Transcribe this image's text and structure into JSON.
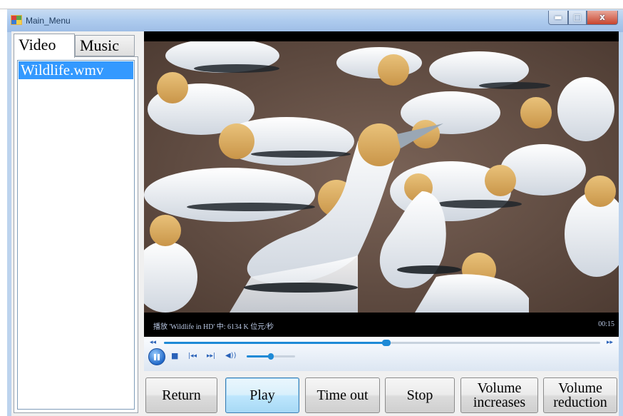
{
  "window": {
    "title": "Main_Menu"
  },
  "caption_buttons": {
    "minimize": "▬",
    "maximize": "□",
    "close": "x"
  },
  "tabs": [
    {
      "label": "Video",
      "selected": true
    },
    {
      "label": "Music",
      "selected": false
    }
  ],
  "video_list": {
    "items": [
      "Wildlife.wmv"
    ],
    "selected_index": 0
  },
  "player": {
    "now_playing": "播放 'Wildlife in HD' 中: 6134 K 位元/秒",
    "elapsed": "00:15",
    "seek_left_glyph": "◂◂",
    "seek_right_glyph": "▸▸",
    "progress_fraction": 0.51,
    "volume_fraction": 0.5,
    "icons": {
      "stop": "■",
      "previous": "|◂◂",
      "next": "▸▸|",
      "volume": "◀))"
    }
  },
  "buttons": {
    "return": "Return",
    "play": "Play",
    "time_out": "Time out",
    "stop": "Stop",
    "volume_increases": "Volume increases",
    "volume_reduction": "Volume reduction"
  },
  "colors": {
    "selection": "#3399ff",
    "accent": "#1e8ad6",
    "title_bar": "#aecbee"
  }
}
